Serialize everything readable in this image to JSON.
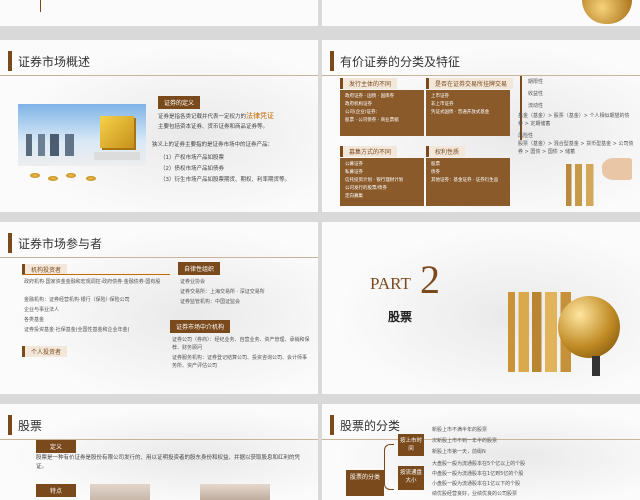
{
  "slide_overview": {
    "title": "证券市场概述",
    "def_label": "证券的定义",
    "line1a": "证券是指各类记载并代表一定权力的",
    "line1b": "法律凭证",
    "line2": "主要包括资本证券、货币证券和商品证券等。",
    "line3": "狭义上的证券主要指的是证券市场中的证券产品：",
    "items": [
      "（1）产权市场产品如股票",
      "（2）债权市场产品如债券",
      "（3）衍生市场产品如股票期货、期权、利率期货等。"
    ]
  },
  "slide_classify": {
    "title": "有价证券的分类及特征",
    "box1_title": "发行主体的不同",
    "box1_items": [
      "政府证券 · 国债 · 国库券",
      "政府机构证券",
      "公司(企业)证券：",
      "股票 · 公司债券 · 商业票据"
    ],
    "box2_title": "是否在证券交易所挂牌交易",
    "box2_items": [
      "上市证券",
      "非上市证券",
      "凭证式国债 · 普通开放式基金"
    ],
    "box3_title": "募集方式的不同",
    "box3_items": [
      "公募证券",
      "私募证券",
      "信托投资计划 · 银行理财计划",
      "公司发行的股票/债券",
      "定向募集"
    ],
    "box4_title": "权利性质",
    "box4_items": [
      "股票",
      "债券",
      "其他证券：基金证券 · 证券衍生品"
    ],
    "right_items": [
      "期限性",
      "收益性",
      "流动性",
      "基金（基金）> 股票（基金）> 个人相似期望的债券 > 定期储蓄",
      "风险性",
      "股票（基金）> 混合型基金 > 货币型基金 > 公司债券 > 国债 > 国债 > 储蓄"
    ]
  },
  "slide_participants": {
    "title": "证券市场参与者",
    "lbl_investors": "机构投资者",
    "investors": [
      "政府机构·国家资金金融和宏观调控·政府债券·金融债券·国有股",
      "金融机构：证券经营机构·银行（保险）·保险公司",
      "企业与事业法人",
      "各类基金",
      "证券投资基金·社保基金(全国性基金和企业年金)"
    ],
    "lbl_personal": "个人投资者",
    "lbl_self": "自律性组织",
    "self_items": [
      "证券业协会",
      "证券交易所：上海交易所 · 深证交易所",
      "证券监管机构：中国证监会"
    ],
    "lbl_intermediary": "证券市场中介机构",
    "intermediary_items": [
      "证券公司（券商）：经纪业务、自营业务、资产管理、承销和保荐、财务顾问",
      "证券服务机构：证券登记结算公司、投资咨询公司、会计师事务所、资产评估公司"
    ]
  },
  "slide_part": {
    "part_word": "PART",
    "part_num": "2",
    "subtitle": "股票"
  },
  "slide_stock": {
    "title": "股票",
    "def_label": "定义",
    "def_text": "股票是一种有价证券是股份有限公司发行的、用以证明投资者的股东身份和权益、并据以获取股息和红利的凭证。",
    "feature_label": "特点"
  },
  "slide_stock_class": {
    "title": "股票的分类",
    "center": "股票的分类",
    "by_listing": "按上市时间",
    "by_size": "按流通盘大小",
    "listing_items": [
      "新股上市不满半年的股票",
      "次新股上市不到一年半的股票",
      "新股上市第一天，前缀N"
    ],
    "size_items": [
      "大盘股一般为流通股本在5个亿以上的个股",
      "中盘股一般为流通股本在1亿到5亿的个股",
      "小盘股一般为流通股本在1亿以下的个股",
      "绩优股经营良好，业绩优良的公司股票"
    ]
  }
}
